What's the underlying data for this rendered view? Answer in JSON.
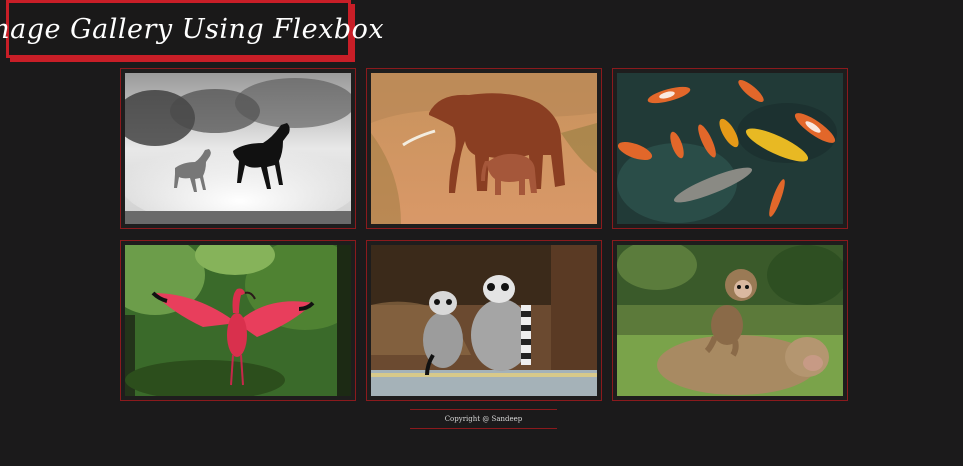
{
  "header": {
    "title": "Image Gallery Using Flexbox"
  },
  "gallery": {
    "images": [
      {
        "subject": "horses running in dust, black and white"
      },
      {
        "subject": "elephant with calf walking on red dirt"
      },
      {
        "subject": "koi fish swimming in pond"
      },
      {
        "subject": "scarlet ibis spreading wings"
      },
      {
        "subject": "two ring-tailed lemurs sitting"
      },
      {
        "subject": "baby monkey riding on adult monkey"
      }
    ]
  },
  "footer": {
    "text": "Copyright @ Sandeep"
  },
  "colors": {
    "background": "#1b1a1b",
    "accent": "#c81e27",
    "card_border": "#8b1a1d",
    "text": "#ffffff"
  }
}
